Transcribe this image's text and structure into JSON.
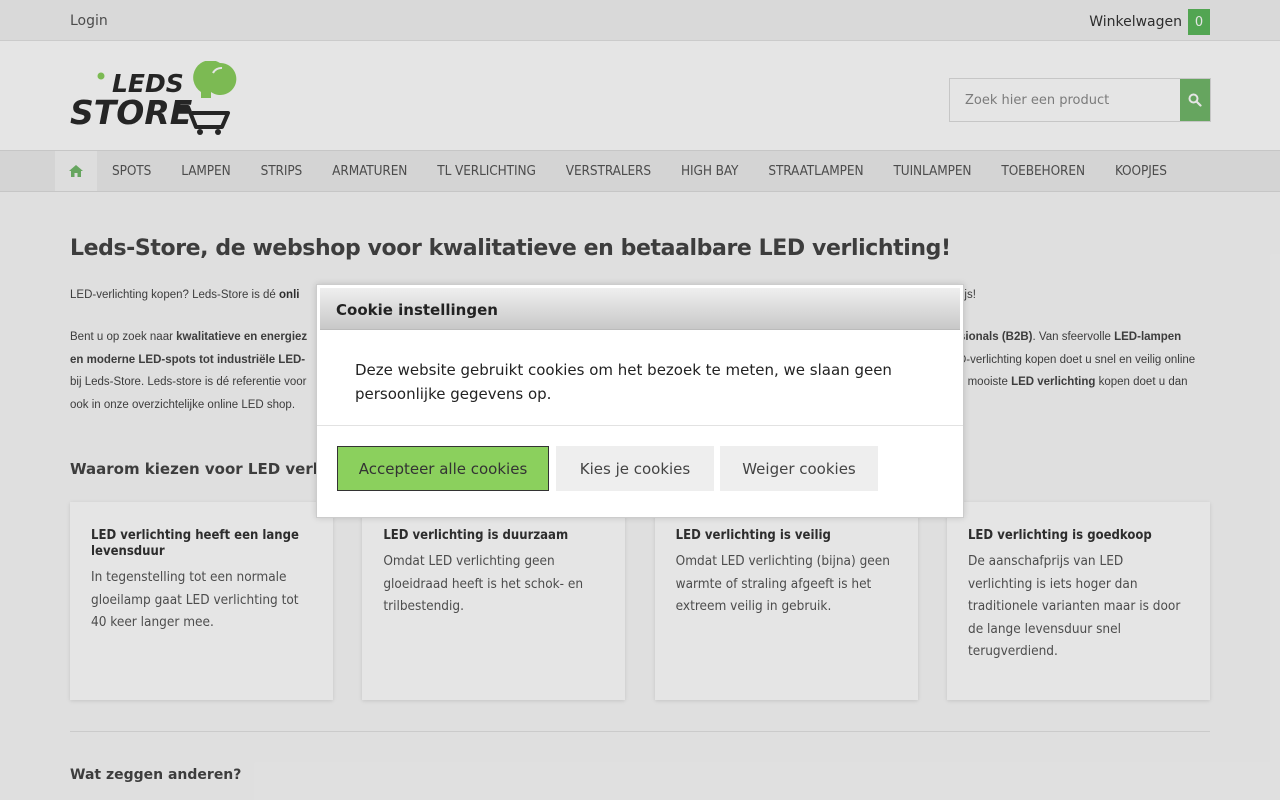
{
  "topbar": {
    "login_label": "Login",
    "cart_label": "Winkelwagen",
    "cart_count": "0"
  },
  "header": {
    "logo_top": "LEDS",
    "logo_bottom": "STORE",
    "search_placeholder": "Zoek hier een product"
  },
  "nav": {
    "items": [
      "SPOTS",
      "LAMPEN",
      "STRIPS",
      "ARMATUREN",
      "TL VERLICHTING",
      "VERSTRALERS",
      "HIGH BAY",
      "STRAATLAMPEN",
      "TUINLAMPEN",
      "TOEBEHOREN",
      "KOOPJES"
    ]
  },
  "main": {
    "title": "Leds-Store, de webshop voor kwalitatieve en betaalbare LED verlichting!",
    "intro_start": "LED-verlichting kopen? Leds-Store is dé ",
    "intro_bold": "onli",
    "intro_end": "rijs!",
    "para2_line1_a": "Bent u op zoek naar ",
    "para2_line1_bold": "kwalitatieve en energiez",
    "para2_line1_right_bold": "sionals (B2B)",
    "para2_line1_right": ". Van sfeervolle ",
    "para2_line1_right_bold2": "LED-lampen",
    "para2_line2_bold": "en moderne LED-spots tot industriële LED-",
    "para2_line2_right": "D-verlichting kopen doet u snel en veilig online",
    "para2_line3_left": "bij Leds-Store. Leds-store is dé referentie voor",
    "para2_line3_right": "e mooiste ",
    "para2_line3_right_bold": "LED verlichting",
    "para2_line3_right_end": " kopen doet u dan",
    "para2_line4": "ook in onze overzichtelijke online LED shop.",
    "why_title": "Waarom kiezen voor LED verlichting?",
    "cards": [
      {
        "title": "LED verlichting heeft een lange levensduur",
        "text": "In tegenstelling tot een normale gloeilamp gaat LED verlichting tot 40 keer langer mee."
      },
      {
        "title": "LED verlichting is duurzaam",
        "text": "Omdat LED verlichting geen gloeidraad heeft is het schok- en trilbestendig."
      },
      {
        "title": "LED verlichting is veilig",
        "text": "Omdat LED verlichting (bijna) geen warmte of straling afgeeft is het extreem veilig in gebruik."
      },
      {
        "title": "LED verlichting is goedkoop",
        "text": "De aanschafprijs van LED verlichting is iets hoger dan traditionele varianten maar is door de lange levensduur snel terugverdiend."
      }
    ],
    "reviews_title": "Wat zeggen anderen?"
  },
  "cookie_modal": {
    "title": "Cookie instellingen",
    "body": "Deze website gebruikt cookies om het bezoek te meten, we slaan geen persoonlijke gegevens op.",
    "accept_label": "Accepteer alle cookies",
    "choose_label": "Kies je cookies",
    "decline_label": "Weiger cookies"
  },
  "colors": {
    "accent_green": "#72b86a",
    "accept_button": "#8bd05d"
  }
}
